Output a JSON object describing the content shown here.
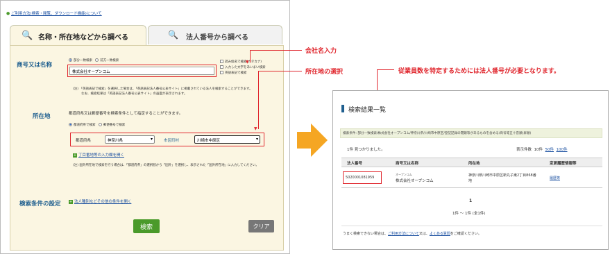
{
  "left": {
    "top_link": "ご利用方法(検索・閲覧、ダウンロード機能)について",
    "tab_active": "名称・所在地などから調べる",
    "tab_inactive": "法人番号から調べる",
    "label_name": "商号又は名称",
    "radio_partial": "部分一致検索",
    "radio_prefix": "前方一致検索",
    "name_input_value": "株式会社オープンコム",
    "check_reading": "読み仮名で検索(カタカナ)",
    "check_diff": "入力した文字をあいまい検索",
    "check_english": "英語表記で検索",
    "note_english": "(注) 「英語表記で検索」を選択した場合は、「英語表記法人番号公表サイト」に掲載されている法人を検索することができます。",
    "note_english2": "なお、検索結果は「英語表記法人番号公表サイト」の画面が表示されます。",
    "label_address": "所在地",
    "address_hint": "都道府県又は郵便番号を検索条件として指定することができます。",
    "radio_pref": "都道府県で検索",
    "radio_zip": "郵便番号で検索",
    "label_pref": "都道府県",
    "pref_value": "神奈川県",
    "label_city": "市区町村",
    "city_value": "川崎市中原区",
    "chome_link": "丁目番地等の入力欄を開く",
    "note_address": "(注) 国外所在地で検索を行う場合は、「都道府県」の選択肢から「国外」を選択し、表示された「国外所在地」に入力してください。",
    "label_condition": "検索条件の設定",
    "condition_link": "法人種別などその他の条件を開く",
    "search_button": "検索",
    "clear_button": "クリア"
  },
  "annotations": {
    "company_name_input": "会社名入力",
    "address_select": "所在地の選択",
    "employee_note": "従業員数を特定するためには法人番号が必要となります。"
  },
  "right": {
    "title": "検索結果一覧",
    "search_condition": "検索条件: 部分一致検索/株式会社オープンコム/神奈川県/川崎市中原区/登記記録の閉鎖等があるものを含める/商号等五十音順(昇順)",
    "count_text": "1件 見つかりました。",
    "display_count_label": "表示件数",
    "display_10": "10件",
    "display_50": "50件",
    "display_100": "100件",
    "col_number": "法人番号",
    "col_name": "商号又は名称",
    "col_address": "所在地",
    "col_history": "変更履歴情報等",
    "row_number": "5020001081959",
    "row_kana": "オープンコム",
    "row_name": "株式会社オープンコム",
    "row_address": "神奈川県川崎市中原区新丸子東2丁目868番地",
    "row_history": "履歴等",
    "page_num": "1",
    "page_range": "1件 ～ 1件 (全1件)",
    "footer_prefix": "うまく検索できない場合は、",
    "footer_link1": "ご利用方法について",
    "footer_mid": "又は、",
    "footer_link2": "よくある質問",
    "footer_suffix": "をご確認ください。"
  },
  "colors": {
    "accent_red": "#e0262d",
    "search_green": "#4a9a2a",
    "arrow_orange": "#f5a623"
  }
}
